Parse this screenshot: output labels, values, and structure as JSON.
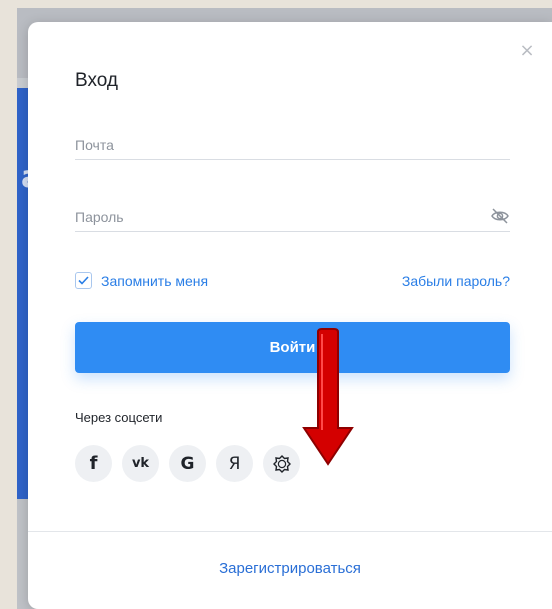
{
  "modal": {
    "title": "Вход",
    "close_symbol": "×",
    "email": {
      "placeholder": "Почта",
      "value": ""
    },
    "password": {
      "placeholder": "Пароль",
      "value": "",
      "toggle_icon": "eye-slash-icon"
    },
    "remember": {
      "label": "Запомнить меня",
      "checked": true
    },
    "forgot_label": "Забыли пароль?",
    "login_label": "Войти",
    "social_title": "Через соцсети",
    "socials": [
      {
        "name": "facebook",
        "glyph": "f"
      },
      {
        "name": "vk",
        "glyph": "vk"
      },
      {
        "name": "google",
        "glyph": "G"
      },
      {
        "name": "yandex",
        "glyph": "Я"
      },
      {
        "name": "other",
        "glyph": ""
      }
    ],
    "register_label": "Зарегистрироваться"
  },
  "colors": {
    "accent": "#2f8cf3",
    "link": "#2a7ee6",
    "annotation_arrow": "#d40000"
  }
}
